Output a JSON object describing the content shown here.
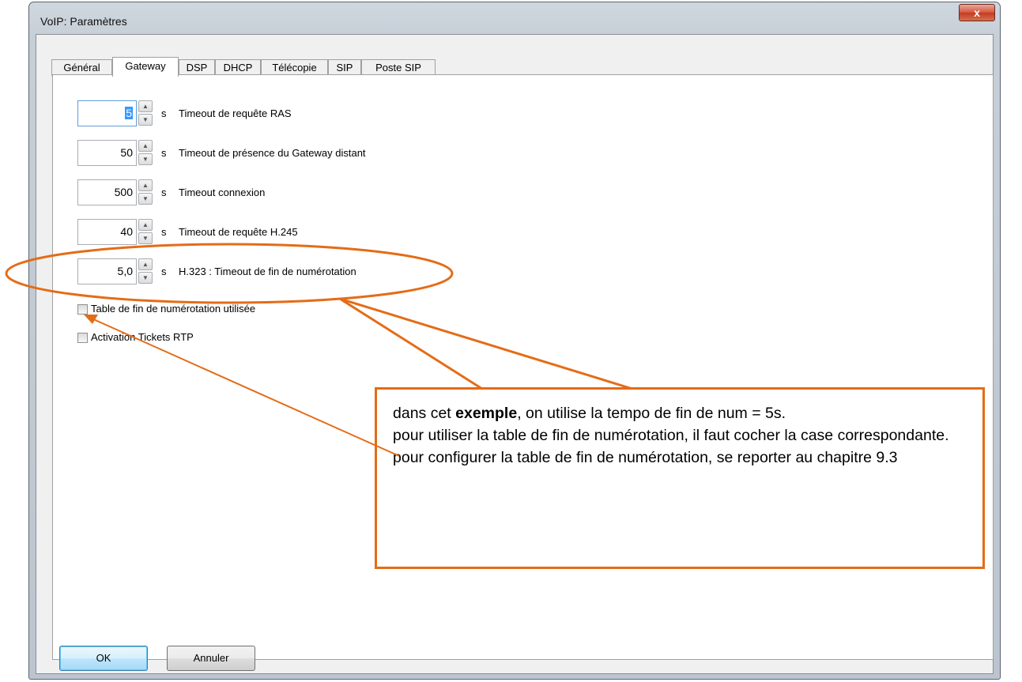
{
  "window": {
    "title": "VoIP: Paramètres",
    "close_glyph": "x"
  },
  "tabs": [
    "Général",
    "Gateway",
    "DSP",
    "DHCP",
    "Télécopie",
    "SIP",
    "Poste SIP"
  ],
  "active_tab": "Gateway",
  "fields": [
    {
      "value": "5",
      "unit": "s",
      "label": "Timeout de requête RAS"
    },
    {
      "value": "50",
      "unit": "s",
      "label": "Timeout de présence du Gateway distant"
    },
    {
      "value": "500",
      "unit": "s",
      "label": "Timeout connexion"
    },
    {
      "value": "40",
      "unit": "s",
      "label": "Timeout de requête H.245"
    },
    {
      "value": "5,0",
      "unit": "s",
      "label": "H.323 : Timeout de fin de numérotation"
    }
  ],
  "checkboxes": [
    {
      "label": "Table de fin de numérotation utilisée",
      "checked": false
    },
    {
      "label": "Activation Tickets RTP",
      "checked": false
    }
  ],
  "buttons": {
    "ok": "OK",
    "cancel": "Annuler"
  },
  "annotation": {
    "line1_before": "dans cet ",
    "line1_bold": "exemple",
    "line1_after": ", on utilise la tempo de fin de num = 5s.",
    "line2": "pour utiliser la table de fin de numérotation, il faut cocher la case correspondante.",
    "line3": "pour configurer la table de fin de numérotation, se reporter au chapitre 9.3",
    "color": "#e46c17"
  }
}
